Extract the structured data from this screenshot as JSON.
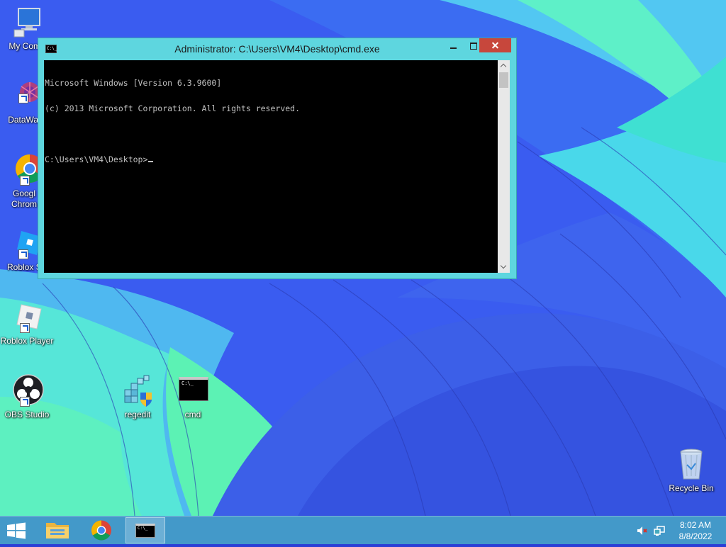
{
  "window": {
    "title": "Administrator: C:\\Users\\VM4\\Desktop\\cmd.exe",
    "icon_text": "C:\\_"
  },
  "console": {
    "lines": [
      "Microsoft Windows [Version 6.3.9600]",
      "(c) 2013 Microsoft Corporation. All rights reserved.",
      "",
      "C:\\Users\\VM4\\Desktop>"
    ]
  },
  "desktop": {
    "icons": {
      "my_computer": "My Comp",
      "datawag": "DataWag",
      "chrome": "Googl Chrom",
      "roblox_studio": "Roblox St",
      "roblox_player": "Roblox Player",
      "obs": "OBS Studio",
      "regedit": "regedit",
      "cmd": "cmd",
      "recycle_bin": "Recycle Bin"
    },
    "cmd_icon_text": "C:\\_"
  },
  "taskbar": {
    "cmd_icon_text": "C:\\_",
    "clock_time": "8:02 AM",
    "clock_date": "8/8/2022"
  },
  "colors": {
    "window_frame": "#5ed6df",
    "close_button": "#c7473c",
    "console_bg": "#000000",
    "console_fg": "#c0c0c0"
  }
}
